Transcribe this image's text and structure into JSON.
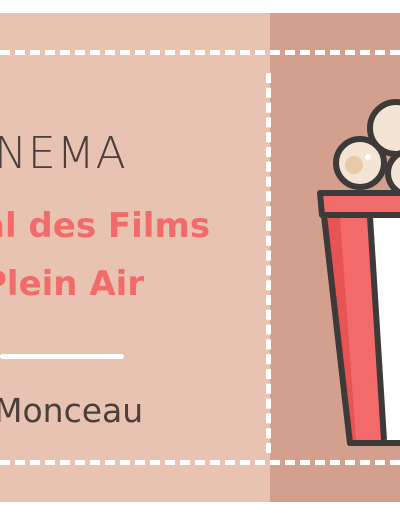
{
  "ticket": {
    "category": "NEMA",
    "title_line1": "al des Films",
    "title_line2": "Plein Air",
    "location": "Monceau"
  },
  "colors": {
    "ticket_main": "#e8c3b2",
    "ticket_stub": "#d2a08c",
    "title_accent": "#f36a6a",
    "text_dark": "#4a3f3a",
    "perforation": "#ffffff"
  },
  "icons": {
    "illustration": "popcorn-icon"
  }
}
